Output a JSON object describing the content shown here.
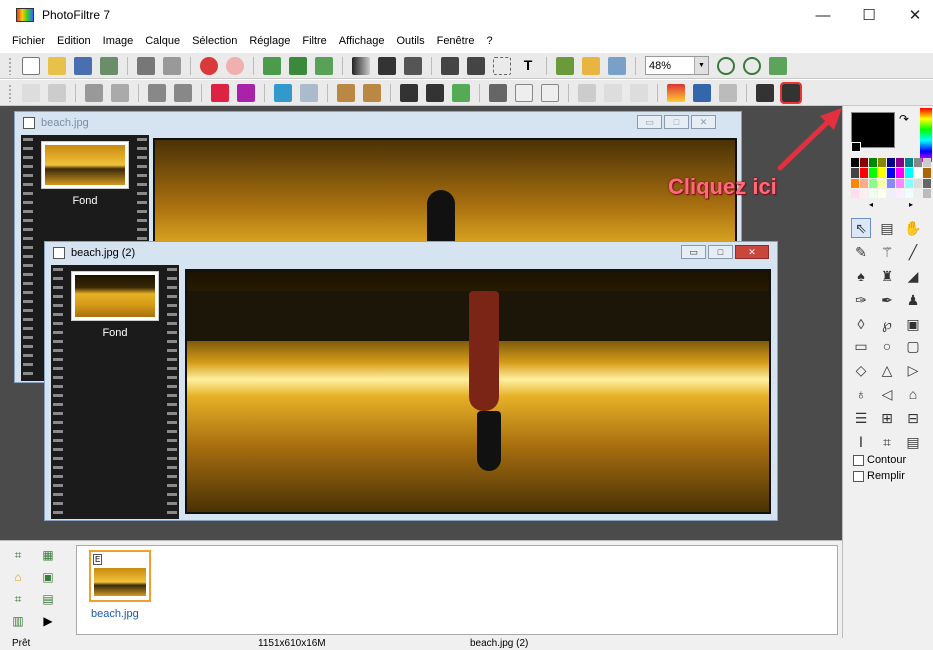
{
  "app": {
    "title": "PhotoFiltre 7",
    "win_minimize": "—",
    "win_maximize": "☐",
    "win_close": "✕"
  },
  "menu": [
    "Fichier",
    "Edition",
    "Image",
    "Calque",
    "Sélection",
    "Réglage",
    "Filtre",
    "Affichage",
    "Outils",
    "Fenêtre",
    "?"
  ],
  "toolbar": {
    "zoom": "48%"
  },
  "windows": {
    "back": {
      "title": "beach.jpg",
      "layer": "Fond"
    },
    "front": {
      "title": "beach.jpg (2)",
      "layer": "Fond"
    }
  },
  "palette": {
    "contour": "Contour",
    "remplir": "Remplir"
  },
  "browser": {
    "file": "beach.jpg",
    "badge": "E"
  },
  "status": {
    "ready": "Prêt",
    "size": "1151x610x16M",
    "doc": "beach.jpg (2)"
  },
  "annotation": {
    "text": "Cliquez ici",
    "color": "#ff6a7a"
  },
  "colors": {
    "workspace": "#4b4b4b",
    "arrow": "#e3303f",
    "window_frame": "#d6e3f1"
  }
}
